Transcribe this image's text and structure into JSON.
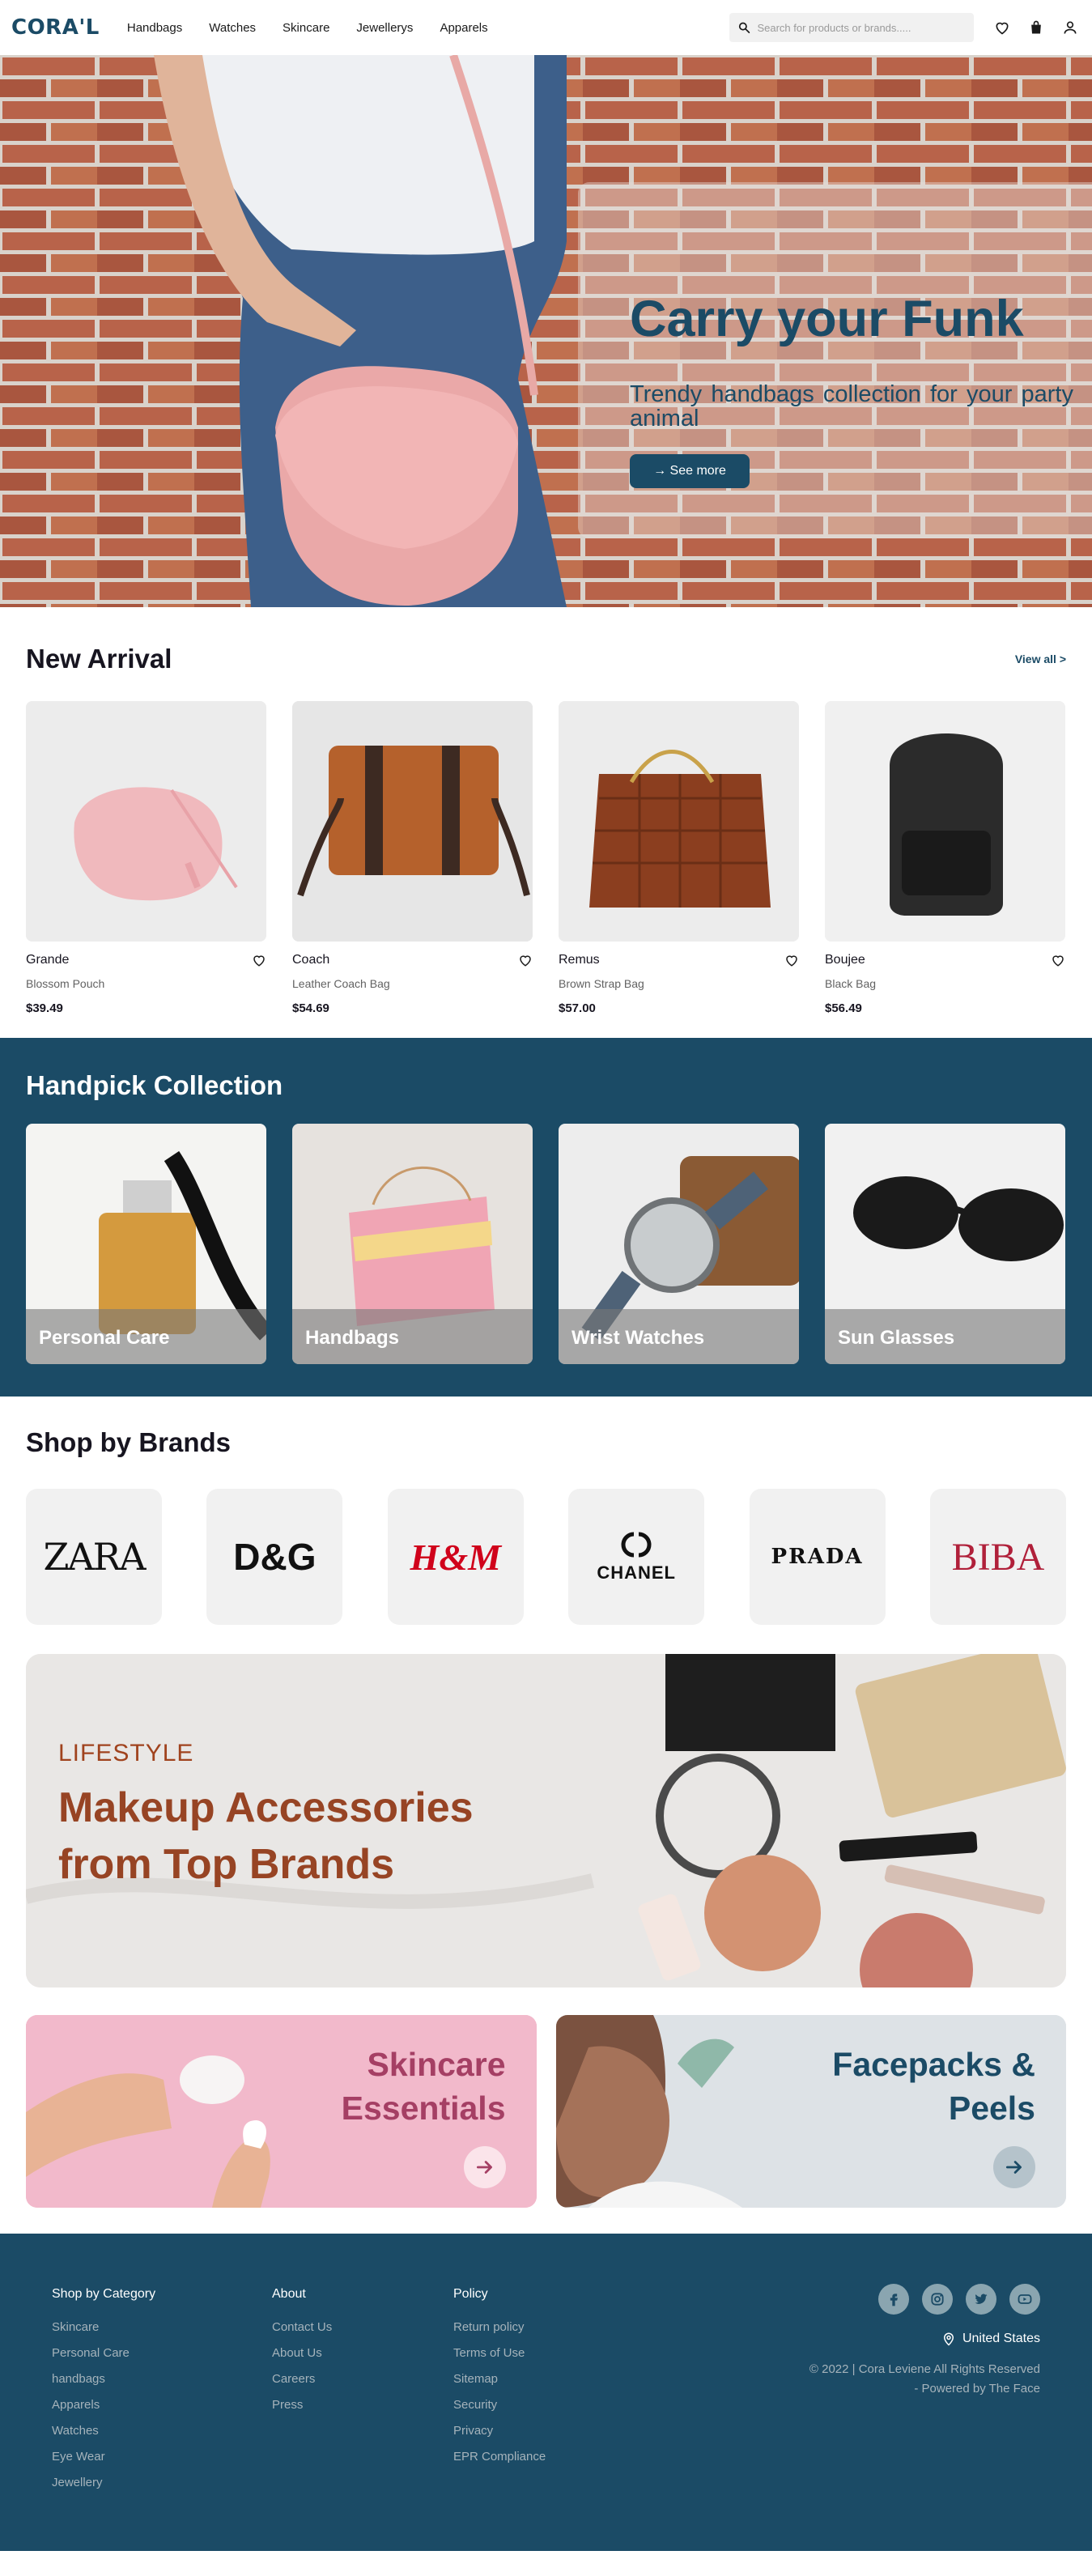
{
  "header": {
    "logo": "CORA'L",
    "nav": [
      "Handbags",
      "Watches",
      "Skincare",
      "Jewellerys",
      "Apparels"
    ],
    "search_placeholder": "Search for products or brands.....",
    "icons": [
      "heart-icon",
      "bag-icon",
      "user-icon"
    ]
  },
  "hero": {
    "title": "Carry your Funk",
    "subtitle": "Trendy handbags collection for your party animal",
    "button": "→ See more"
  },
  "new_arrival": {
    "title": "New Arrival",
    "view_all": "View all >",
    "products": [
      {
        "name": "Grande",
        "desc": "Blossom Pouch",
        "price": "$39.49"
      },
      {
        "name": "Coach",
        "desc": "Leather Coach Bag",
        "price": "$54.69"
      },
      {
        "name": "Remus",
        "desc": "Brown Strap Bag",
        "price": "$57.00"
      },
      {
        "name": "Boujee",
        "desc": "Black Bag",
        "price": "$56.49"
      }
    ]
  },
  "handpick": {
    "title": "Handpick Collection",
    "items": [
      "Personal Care",
      "Handbags",
      "Wrist Watches",
      "Sun Glasses"
    ]
  },
  "brands": {
    "title": "Shop by Brands",
    "items": [
      "ZARA",
      "D&G",
      "H&M",
      "CHANEL",
      "PRADA",
      "BIBA"
    ]
  },
  "makeup": {
    "tag": "LIFESTYLE",
    "title": "Makeup Accessories from Top Brands"
  },
  "promos": [
    {
      "title": "Skincare Essentials",
      "color": "#a53f64"
    },
    {
      "title": "Facepacks & Peels",
      "color": "#1b4b66"
    }
  ],
  "footer": {
    "columns": [
      {
        "heading": "Shop by Category",
        "links": [
          "Skincare",
          "Personal Care",
          "handbags",
          "Apparels",
          "Watches",
          "Eye Wear",
          "Jewellery"
        ]
      },
      {
        "heading": "About",
        "links": [
          "Contact Us",
          "About Us",
          "Careers",
          "Press"
        ]
      },
      {
        "heading": "Policy",
        "links": [
          "Return policy",
          "Terms of Use",
          "Sitemap",
          "Security",
          "Privacy",
          "EPR Compliance"
        ]
      }
    ],
    "location": "United States",
    "copyright": "© 2022 | Cora Leviene All Rights Reserved",
    "powered": "- Powered by The Face"
  },
  "colors": {
    "primary": "#1b4b66",
    "accent_brown": "#974424",
    "accent_pink": "#a53f64"
  }
}
